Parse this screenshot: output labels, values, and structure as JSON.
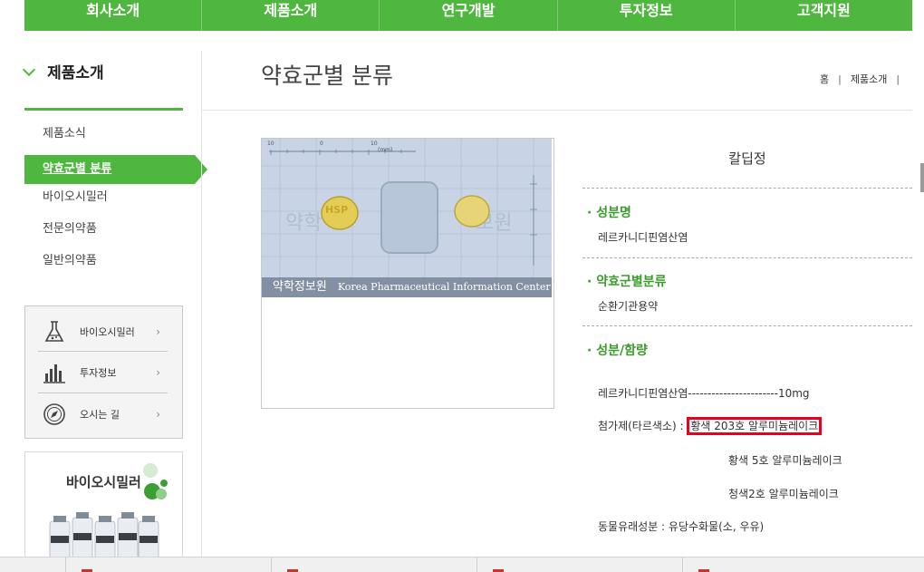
{
  "topnav": [
    "회사소개",
    "제품소개",
    "연구개발",
    "투자정보",
    "고객지원"
  ],
  "sidebar": {
    "title": "제품소개",
    "items": [
      {
        "label": "제품소식"
      },
      {
        "label": "약효군별 분류"
      },
      {
        "label": "바이오시밀러"
      },
      {
        "label": "전문의약품"
      },
      {
        "label": "일반의약품"
      }
    ],
    "quick": [
      {
        "label": "바이오시밀러",
        "arrow": "›"
      },
      {
        "label": "투자정보",
        "arrow": "›"
      },
      {
        "label": "오시는 길",
        "arrow": "›"
      }
    ],
    "promo_title": "바이오시밀러"
  },
  "page": {
    "title": "약효군별 분류",
    "breadcrumb": [
      "홈",
      "제품소개"
    ]
  },
  "image": {
    "pill_text": "HSP",
    "banner_ko": "약학정보원",
    "banner_en": "Korea Pharmaceutical Information Center",
    "ruler_labels": [
      "10",
      "0",
      "10",
      "(mm)"
    ]
  },
  "detail": {
    "name": "칼딥정",
    "sections": [
      {
        "heading": "· 성분명",
        "value": "레르카니디핀염산염"
      },
      {
        "heading": "· 약효군별분류",
        "value": "순환기관용약"
      },
      {
        "heading": "· 성분/함량",
        "value": ""
      }
    ],
    "ingredient_line": "레르카니디핀염산염-----------------------10mg",
    "additive_label": "첨가제(타르색소) : ",
    "additive_highlight": "황색 203호 알루미늄레이크",
    "additive_2": "황색 5호 알루미늄레이크",
    "additive_3": "청색2호 알루미늄레이크",
    "animal_line": "동물유래성분 : 유당수화물(소, 우유)"
  },
  "colors": {
    "brand_green": "#4fb63f",
    "heading_green": "#3b9c2c",
    "highlight_red": "#e8001c"
  }
}
